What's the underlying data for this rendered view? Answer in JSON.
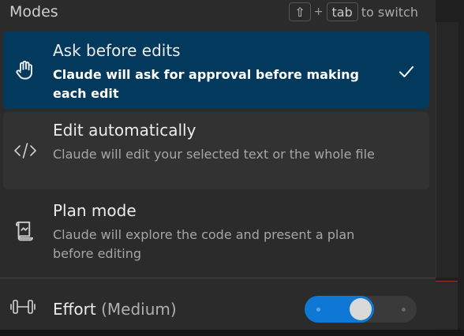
{
  "header": {
    "title": "Modes",
    "shortcut": {
      "key1": "⇧",
      "plus": "+",
      "key2": "tab",
      "suffix": "to switch"
    }
  },
  "modes": [
    {
      "title": "Ask before edits",
      "description": "Claude will ask for approval before making each edit",
      "icon": "hand-icon",
      "selected": true
    },
    {
      "title": "Edit automatically",
      "description": "Claude will edit your selected text or the whole file",
      "icon": "code-icon",
      "selected": false
    },
    {
      "title": "Plan mode",
      "description": "Claude will explore the code and present a plan before editing",
      "icon": "scroll-icon",
      "selected": false
    }
  ],
  "effort": {
    "label": "Effort",
    "level": "(Medium)",
    "icon": "dumbbell-icon",
    "slider": {
      "steps": 3,
      "selected_index": 1
    }
  },
  "colors": {
    "selected_bg": "#04395e",
    "accent": "#0e78d4"
  }
}
